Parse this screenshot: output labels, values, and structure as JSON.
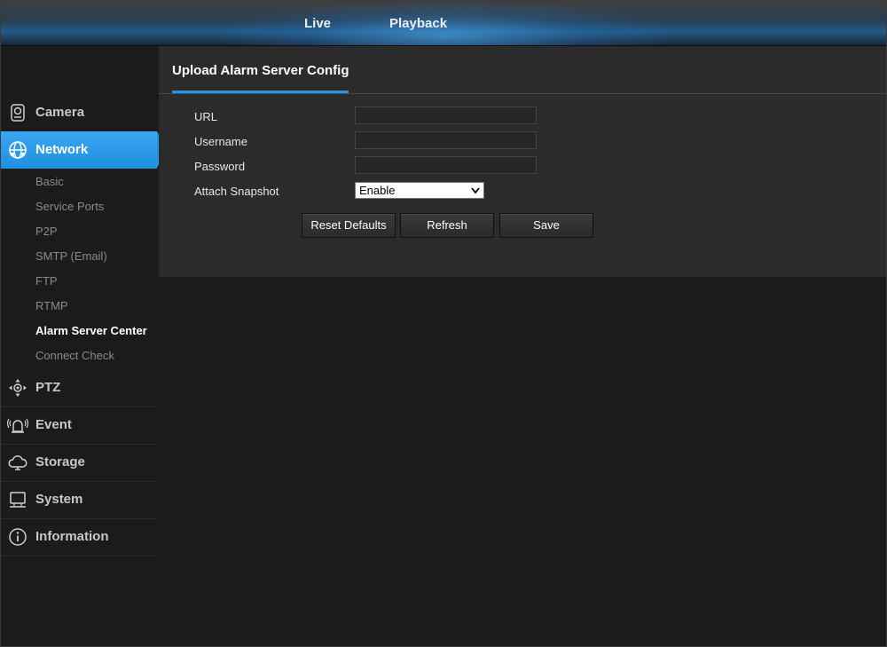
{
  "topnav": {
    "tabs": [
      {
        "label": "Live"
      },
      {
        "label": "Playback"
      }
    ]
  },
  "sidebar": {
    "items": [
      {
        "label": "Camera",
        "icon": "camera-icon"
      },
      {
        "label": "Network",
        "icon": "network-icon",
        "active": true
      },
      {
        "label": "PTZ",
        "icon": "ptz-icon"
      },
      {
        "label": "Event",
        "icon": "alarm-icon"
      },
      {
        "label": "Storage",
        "icon": "cloud-storage-icon"
      },
      {
        "label": "System",
        "icon": "monitor-icon"
      },
      {
        "label": "Information",
        "icon": "info-icon"
      }
    ],
    "network_subitems": [
      {
        "label": "Basic"
      },
      {
        "label": "Service Ports"
      },
      {
        "label": "P2P"
      },
      {
        "label": "SMTP (Email)"
      },
      {
        "label": "FTP"
      },
      {
        "label": "RTMP"
      },
      {
        "label": "Alarm Server Center",
        "current": true
      },
      {
        "label": "Connect Check"
      }
    ]
  },
  "panel": {
    "title": "Upload Alarm Server Config",
    "fields": {
      "url": {
        "label": "URL",
        "value": ""
      },
      "username": {
        "label": "Username",
        "value": ""
      },
      "password": {
        "label": "Password",
        "value": ""
      },
      "attach_snapshot": {
        "label": "Attach Snapshot",
        "selected": "Enable"
      }
    },
    "buttons": {
      "reset": "Reset Defaults",
      "refresh": "Refresh",
      "save": "Save"
    }
  },
  "colors": {
    "accent": "#2596e6",
    "background": "#1b1b1b",
    "panel": "#2b2b2b"
  }
}
